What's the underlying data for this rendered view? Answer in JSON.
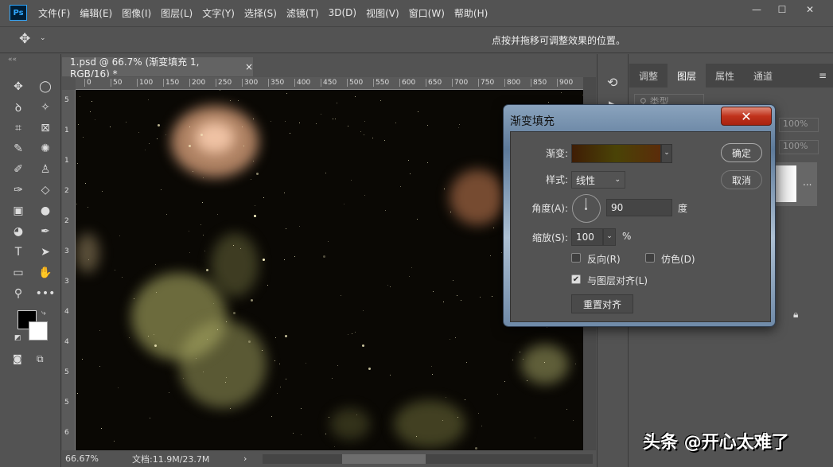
{
  "menubar": {
    "logo": "Ps",
    "items": [
      "文件(F)",
      "编辑(E)",
      "图像(I)",
      "图层(L)",
      "文字(Y)",
      "选择(S)",
      "滤镜(T)",
      "3D(D)",
      "视图(V)",
      "窗口(W)",
      "帮助(H)"
    ]
  },
  "options": {
    "hint": "点按并拖移可调整效果的位置。"
  },
  "document": {
    "tab_title": "1.psd @ 66.7% (渐变填充 1, RGB/16) *",
    "close": "×"
  },
  "ruler": {
    "h_ticks": [
      "0",
      "50",
      "100",
      "150",
      "200",
      "250",
      "300",
      "350",
      "400",
      "450",
      "500",
      "550",
      "600",
      "650",
      "700",
      "750",
      "800",
      "850",
      "900",
      "9"
    ],
    "v_ticks": [
      "5",
      "1",
      "1",
      "2",
      "2",
      "3",
      "3",
      "4",
      "4",
      "5",
      "5",
      "6"
    ]
  },
  "status": {
    "zoom": "66.67%",
    "doc": "文档:11.9M/23.7M",
    "arrow": "›"
  },
  "panel": {
    "tabs": [
      "调整",
      "图层",
      "属性",
      "通道"
    ],
    "active_tab": "图层",
    "search_placeholder": "类型",
    "opacity": "100%",
    "fill": "100%",
    "layer_more": "..."
  },
  "dialog": {
    "title": "渐变填充",
    "gradient_label": "渐变:",
    "gradient_colors": [
      "#3f1d05",
      "#4a4306",
      "#5b2c0a"
    ],
    "style_label": "样式:",
    "style_value": "线性",
    "angle_label": "角度(A):",
    "angle_value": "90",
    "angle_unit": "度",
    "scale_label": "缩放(S):",
    "scale_value": "100",
    "scale_unit": "%",
    "reverse_label": "反向(R)",
    "reverse_checked": false,
    "dither_label": "仿色(D)",
    "dither_checked": false,
    "align_label": "与图层对齐(L)",
    "align_checked": true,
    "reset_label": "重置对齐",
    "ok_label": "确定",
    "cancel_label": "取消"
  },
  "watermark": "头条 @开心太难了"
}
